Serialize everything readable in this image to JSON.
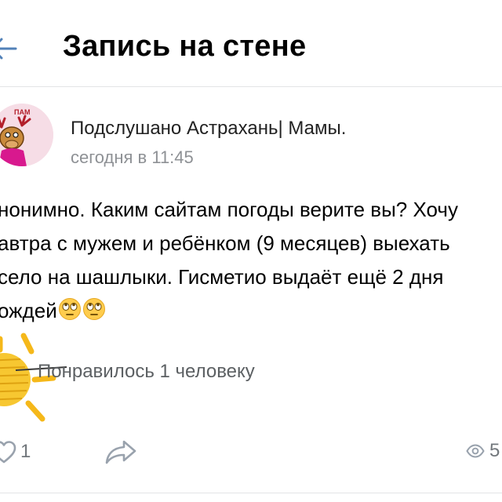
{
  "header": {
    "title": "Запись на стене"
  },
  "post": {
    "author": "Подслушано Астрахань| Мамы.",
    "avatar_text": "ПАМ",
    "time": "сегодня в 11:45",
    "text_lines": [
      "нонимно. Каким сайтам погоды верите вы? Хочу",
      "автра с мужем и ребёнком (9 месяцев) выехать",
      "село на шашлыки. Гисметио выдаёт ещё 2 дня",
      "ождей"
    ],
    "emojis": [
      "face-with-rolling-eyes",
      "face-with-rolling-eyes"
    ],
    "likes_text": "Понравилось 1 человеку",
    "like_count": "1",
    "views_count": "5"
  },
  "colors": {
    "accent": "#5181b8",
    "secondary_text": "#8e9195",
    "icon": "#99a2ad",
    "sun": "#f5b81a"
  }
}
